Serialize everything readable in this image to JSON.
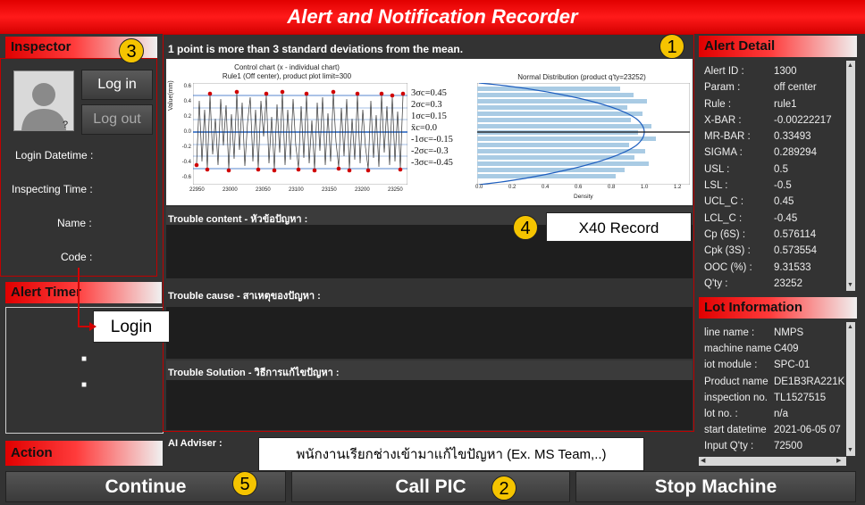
{
  "app": {
    "title": "Alert and Notification Recorder"
  },
  "inspector": {
    "header": "Inspector",
    "login_button": "Log in",
    "logout_button": "Log out",
    "fields": [
      "Login Datetime :",
      "Inspecting Time :",
      "Name :",
      "Code :"
    ]
  },
  "alert_timer": {
    "header": "Alert Timer",
    "markers": [
      "■",
      "■"
    ]
  },
  "action": {
    "header": "Action"
  },
  "main": {
    "message": "1 point is more than 3 standard deviations from the mean.",
    "control_chart": {
      "title_line1": "Control chart (x - individual chart)",
      "title_line2": "Rule1 (Off center), product plot limit=300",
      "ylabel": "Value(mm)",
      "yticks": [
        "0.6",
        "0.4",
        "0.2",
        "0.0",
        "-0.2",
        "-0.4",
        "-0.6"
      ],
      "xticks": [
        "22950",
        "23000",
        "23050",
        "23100",
        "23150",
        "23200",
        "23250"
      ]
    },
    "sigma_labels": [
      "3σc=0.45",
      "2σc=0.3",
      "1σc=0.15",
      "x̄c=0.0",
      "-1σc=-0.15",
      "-2σc=-0.3",
      "-3σc=-0.45"
    ],
    "dist_chart": {
      "title": "Normal Distribution (product q'ty=23252)",
      "xlabel": "Density",
      "xticks": [
        "0.0",
        "0.2",
        "0.4",
        "0.6",
        "0.8",
        "1.0",
        "1.2"
      ]
    },
    "trouble_content_label": "Trouble content - หัวข้อปัญหา :",
    "trouble_cause_label": "Trouble cause - สาเหตุของปัญหา :",
    "trouble_solution_label": "Trouble Solution - วิธีการแก้ไขปัญหา :",
    "ai_adviser_label": "AI Adviser :"
  },
  "alert_detail": {
    "header": "Alert Detail",
    "rows": [
      {
        "k": "Alert ID :",
        "v": "1300"
      },
      {
        "k": "Param :",
        "v": "off center"
      },
      {
        "k": "Rule :",
        "v": "rule1"
      },
      {
        "k": "X-BAR :",
        "v": "-0.00222217"
      },
      {
        "k": "MR-BAR :",
        "v": "0.33493"
      },
      {
        "k": "SIGMA :",
        "v": "0.289294"
      },
      {
        "k": "USL :",
        "v": "0.5"
      },
      {
        "k": "LSL :",
        "v": "-0.5"
      },
      {
        "k": "UCL_C :",
        "v": "0.45"
      },
      {
        "k": "LCL_C :",
        "v": "-0.45"
      },
      {
        "k": "Cp (6S) :",
        "v": "0.576114"
      },
      {
        "k": "Cpk (3S) :",
        "v": "0.573554"
      },
      {
        "k": "OOC (%) :",
        "v": "9.31533"
      },
      {
        "k": "Q'ty :",
        "v": "23252"
      }
    ]
  },
  "lot_information": {
    "header": "Lot Information",
    "rows": [
      {
        "k": "line name :",
        "v": "NMPS"
      },
      {
        "k": "machine name",
        "v": "C409"
      },
      {
        "k": "iot module :",
        "v": "SPC-01"
      },
      {
        "k": "Product name",
        "v": "DE1B3RA221K"
      },
      {
        "k": "inspection no.",
        "v": "TL1527515"
      },
      {
        "k": "lot no. :",
        "v": "n/a"
      },
      {
        "k": "start datetime",
        "v": "2021-06-05 07"
      },
      {
        "k": "Input Q'ty :",
        "v": "72500"
      }
    ]
  },
  "buttons": {
    "continue": "Continue",
    "call_pic": "Call PIC",
    "stop_machine": "Stop Machine"
  },
  "annotations": {
    "badges": [
      "1",
      "2",
      "3",
      "4",
      "5"
    ],
    "x40_record": "X40 Record",
    "login": "Login",
    "ms_team": "พนักงานเรียกช่างเข้ามาแก้ไขปัญหา (Ex. MS Team,..)"
  },
  "colors": {
    "accent": "#e00000",
    "badge": "#f5c400",
    "panel": "#333333",
    "hist": "#a9cbe4",
    "line": "#1f5fbf"
  },
  "icons": {
    "avatar": "avatar-placeholder-icon",
    "scroll_up": "arrow-up-icon",
    "scroll_down": "arrow-down-icon"
  }
}
